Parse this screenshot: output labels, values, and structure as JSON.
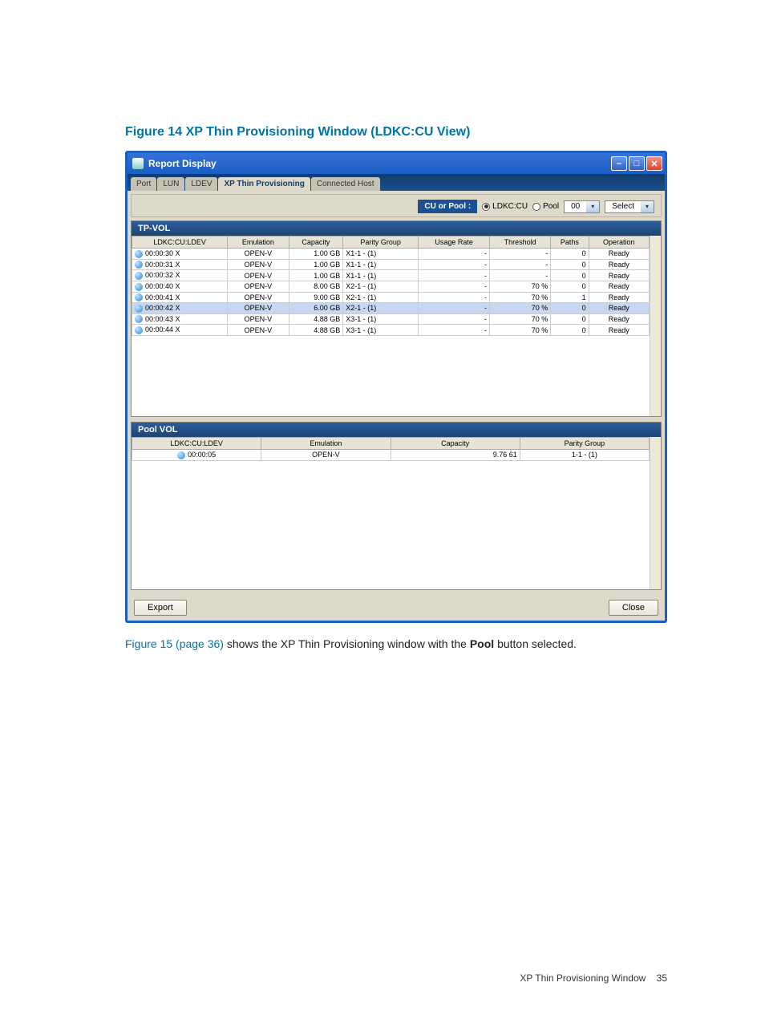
{
  "figure_title": "Figure 14 XP Thin Provisioning Window (LDKC:CU View)",
  "window_title": "Report Display",
  "tabs": [
    "Port",
    "LUN",
    "LDEV",
    "XP Thin Provisioning",
    "Connected Host"
  ],
  "active_tab_index": 3,
  "filter": {
    "label": "CU or Pool :",
    "radio1": "LDKC:CU",
    "radio2": "Pool",
    "dd1": "00",
    "dd2": "Select"
  },
  "tpvol": {
    "title": "TP-VOL",
    "headers": [
      "LDKC:CU:LDEV",
      "Emulation",
      "Capacity",
      "Parity Group",
      "Usage Rate",
      "Threshold",
      "Paths",
      "Operation"
    ],
    "rows": [
      {
        "ldev": "00:00:30 X",
        "em": "OPEN-V",
        "cap": "1.00 GB",
        "pg": "X1-1 - (1)",
        "ur": "-",
        "th": "-",
        "paths": "0",
        "op": "Ready",
        "sel": false
      },
      {
        "ldev": "00:00:31 X",
        "em": "OPEN-V",
        "cap": "1.00 GB",
        "pg": "X1-1 - (1)",
        "ur": "-",
        "th": "-",
        "paths": "0",
        "op": "Ready",
        "sel": false
      },
      {
        "ldev": "00:00:32 X",
        "em": "OPEN-V",
        "cap": "1.00 GB",
        "pg": "X1-1 - (1)",
        "ur": "-",
        "th": "-",
        "paths": "0",
        "op": "Ready",
        "sel": false
      },
      {
        "ldev": "00:00:40 X",
        "em": "OPEN-V",
        "cap": "8.00 GB",
        "pg": "X2-1 - (1)",
        "ur": "-",
        "th": "70 %",
        "paths": "0",
        "op": "Ready",
        "sel": false
      },
      {
        "ldev": "00:00:41 X",
        "em": "OPEN-V",
        "cap": "9.00 GB",
        "pg": "X2-1 - (1)",
        "ur": "-",
        "th": "70 %",
        "paths": "1",
        "op": "Ready",
        "sel": false
      },
      {
        "ldev": "00:00:42 X",
        "em": "OPEN-V",
        "cap": "6.00 GB",
        "pg": "X2-1 - (1)",
        "ur": "-",
        "th": "70 %",
        "paths": "0",
        "op": "Ready",
        "sel": true
      },
      {
        "ldev": "00:00:43 X",
        "em": "OPEN-V",
        "cap": "4.88 GB",
        "pg": "X3-1 - (1)",
        "ur": "-",
        "th": "70 %",
        "paths": "0",
        "op": "Ready",
        "sel": false
      },
      {
        "ldev": "00:00:44 X",
        "em": "OPEN-V",
        "cap": "4.88 GB",
        "pg": "X3-1 - (1)",
        "ur": "-",
        "th": "70 %",
        "paths": "0",
        "op": "Ready",
        "sel": false
      }
    ]
  },
  "poolvol": {
    "title": "Pool VOL",
    "headers": [
      "LDKC:CU:LDEV",
      "Emulation",
      "Capacity",
      "Parity Group"
    ],
    "rows": [
      {
        "ldev": "00:00:05",
        "em": "OPEN-V",
        "cap": "9.76 61",
        "pg": "1-1 - (1)"
      }
    ]
  },
  "buttons": {
    "export": "Export",
    "close": "Close"
  },
  "caption_link": "Figure 15 (page 36)",
  "caption_mid": " shows the XP Thin Provisioning window with the ",
  "caption_bold": "Pool",
  "caption_end": " button selected.",
  "footer_text": "XP Thin Provisioning Window",
  "footer_page": "35"
}
